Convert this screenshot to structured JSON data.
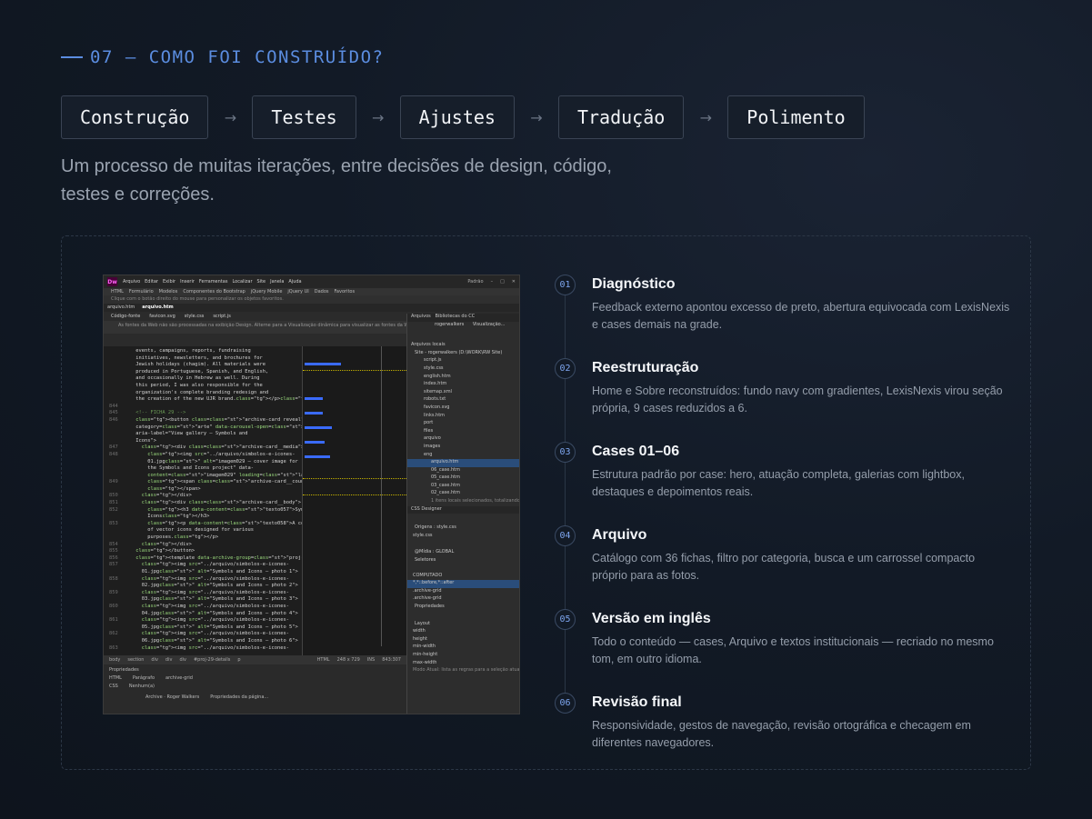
{
  "section": {
    "label": "07 — COMO FOI CONSTRUÍDO?"
  },
  "steps": [
    {
      "label": "Construção"
    },
    {
      "label": "Testes"
    },
    {
      "label": "Ajustes"
    },
    {
      "label": "Tradução"
    },
    {
      "label": "Polimento"
    }
  ],
  "arrow": "→",
  "intro": {
    "line1": "Um processo de muitas iterações, entre decisões de design, código,",
    "line2": "testes e correções."
  },
  "screenshot": {
    "app_logo": "Dw",
    "menu": [
      "Arquivo",
      "Editar",
      "Exibir",
      "Inserir",
      "Ferramentas",
      "Localizar",
      "Site",
      "Janela",
      "Ajuda"
    ],
    "workspace": "Padrão",
    "insert_tabs": [
      "HTML",
      "Formulário",
      "Modelos",
      "Componentes do Bootstrap",
      "jQuery Mobile",
      "jQuery UI",
      "Dados",
      "Favoritos"
    ],
    "hint": "Clique com o botão direito do mouse para personalizar os objetos favoritos.",
    "doc_tabs": [
      "arquivo.htm",
      "arquivo.htm"
    ],
    "file_tabs": [
      "Código-fonte",
      "favicon.svg",
      "style.css",
      "script.js"
    ],
    "warning": "As fontes da Web não são processadas na exibição Design. Alterne para a Visualização dinâmica para visualizar as fontes da Web.",
    "panel_tabs": [
      "Arquivos",
      "Bibliotecas do CC"
    ],
    "site_name": "rogerwalkers",
    "view_mode": "Visualização...",
    "local_files": "Arquivos locais",
    "files": [
      "Site - rogerwalkers (D:\\WORK\\RW Site)",
      "script.js",
      "style.css",
      "english.htm",
      "index.htm",
      "sitemap.xml",
      "robots.txt",
      "favicon.svg",
      "links.htm",
      "port",
      "files",
      "arquivo",
      "images",
      "eng",
      "arquivo.htm",
      "06_case.htm",
      "05_case.htm",
      "03_case.htm",
      "02_case.htm"
    ],
    "files_status": "1 itens locais selecionados, totalizando...",
    "css_designer": "CSS Designer",
    "css_origins": "Origens : style.css",
    "css_media": "@Mídia : GLOBAL",
    "css_selectors": "Seletores",
    "css_computed": "COMPUTADO",
    "css_selected": "*,*::before,*::after",
    "css_rules": [
      ".archive-grid",
      ".archive-grid"
    ],
    "css_props": "Propriedades",
    "css_layout": "Layout",
    "css_layout_props": [
      "width",
      "height",
      "min-width",
      "min-height",
      "max-width",
      "max-height"
    ],
    "css_footer": "Modo Atual: lista as regras para a seleção atual",
    "status_tags": [
      "body",
      "section",
      "div",
      "div",
      "div",
      "#proj-29-details",
      "p"
    ],
    "status_info": "HTML",
    "status_size": "248 x 729",
    "status_ins": "INS",
    "status_pos": "843:307",
    "props_title": "Propriedades",
    "props_html": "HTML",
    "props_css": "CSS",
    "props_format": "Parágrafo",
    "props_id": "Nenhum(a)",
    "props_class": "archive-grid",
    "props_doc_title": "Archive · Roger Walkers",
    "props_page_props": "Propriedades da página...",
    "code_lines": [
      [
        "",
        "events, campaigns, reports, fundraising"
      ],
      [
        "",
        "initiatives, newsletters, and brochures for"
      ],
      [
        "",
        "Jewish holidays (chagim). All materials were"
      ],
      [
        "",
        "produced in Portuguese, Spanish, and English,"
      ],
      [
        "",
        "and occasionally in Hebrew as well. During"
      ],
      [
        "",
        "this period, I was also responsible for the"
      ],
      [
        "",
        "organization's complete branding redesign and"
      ],
      [
        "",
        "the creation of the new UJR brand.</p></div>"
      ],
      [
        "844",
        ""
      ],
      [
        "845",
        "<!-- FICHA 29 -->"
      ],
      [
        "846",
        "<button class=\"archive-card reveal\" data-"
      ],
      [
        "",
        "category=\"arte\" data-carousel-open=\"proj-29\""
      ],
      [
        "",
        "aria-label=\"View gallery — Symbols and"
      ],
      [
        "",
        "Icons\">"
      ],
      [
        "847",
        "  <div class=\"archive-card__media\">"
      ],
      [
        "848",
        "    <img src=\"../arquivo/simbolos-e-icones-"
      ],
      [
        "",
        "    01.jpg\" alt=\"imagem029 — cover image for"
      ],
      [
        "",
        "    the Symbols and Icons project\" data-"
      ],
      [
        "",
        "    content=\"imagem029\" loading=\"lazy\">"
      ],
      [
        "849",
        "    <span class=\"archive-card__count\">1/—"
      ],
      [
        "",
        "    </span>"
      ],
      [
        "850",
        "  </div>"
      ],
      [
        "851",
        "  <div class=\"archive-card__body\">"
      ],
      [
        "852",
        "    <h3 data-content=\"texto057\">Symbols and"
      ],
      [
        "",
        "    Icons</h3>"
      ],
      [
        "853",
        "    <p data-content=\"texto058\">A collection"
      ],
      [
        "",
        "    of vector icons designed for various"
      ],
      [
        "",
        "    purposes.</p>"
      ],
      [
        "854",
        "  </div>"
      ],
      [
        "855",
        "</button>"
      ],
      [
        "856",
        "<template data-archive-group=\"proj-29\">"
      ],
      [
        "857",
        "  <img src=\"../arquivo/simbolos-e-icones-"
      ],
      [
        "",
        "  01.jpg\" alt=\"Symbols and Icons — photo 1\">"
      ],
      [
        "858",
        "  <img src=\"../arquivo/simbolos-e-icones-"
      ],
      [
        "",
        "  02.jpg\" alt=\"Symbols and Icons — photo 2\">"
      ],
      [
        "859",
        "  <img src=\"../arquivo/simbolos-e-icones-"
      ],
      [
        "",
        "  03.jpg\" alt=\"Symbols and Icons — photo 3\">"
      ],
      [
        "860",
        "  <img src=\"../arquivo/simbolos-e-icones-"
      ],
      [
        "",
        "  04.jpg\" alt=\"Symbols and Icons — photo 4\">"
      ],
      [
        "861",
        "  <img src=\"../arquivo/simbolos-e-icones-"
      ],
      [
        "",
        "  05.jpg\" alt=\"Symbols and Icons — photo 5\">"
      ],
      [
        "862",
        "  <img src=\"../arquivo/simbolos-e-icones-"
      ],
      [
        "",
        "  06.jpg\" alt=\"Symbols and Icons — photo 6\">"
      ],
      [
        "863",
        "  <img src=\"../arquivo/simbolos-e-icones-"
      ]
    ]
  },
  "timeline": [
    {
      "num": "01",
      "title": "Diagnóstico",
      "desc": "Feedback externo apontou excesso de preto, abertura equivocada com LexisNexis e cases demais na grade."
    },
    {
      "num": "02",
      "title": "Reestruturação",
      "desc": "Home e Sobre reconstruídos: fundo navy com gradientes, LexisNexis virou seção própria, 9 cases reduzidos a 6."
    },
    {
      "num": "03",
      "title": "Cases 01–06",
      "desc": "Estrutura padrão por case: hero, atuação completa, galerias com lightbox, destaques e depoimentos reais."
    },
    {
      "num": "04",
      "title": "Arquivo",
      "desc": "Catálogo com 36 fichas, filtro por categoria, busca e um carrossel compacto próprio para as fotos."
    },
    {
      "num": "05",
      "title": "Versão em inglês",
      "desc": "Todo o conteúdo — cases, Arquivo e textos institucionais — recriado no mesmo tom, em outro idioma."
    },
    {
      "num": "06",
      "title": "Revisão final",
      "desc": "Responsividade, gestos de navegação, revisão ortográfica e checagem em diferentes navegadores."
    }
  ]
}
